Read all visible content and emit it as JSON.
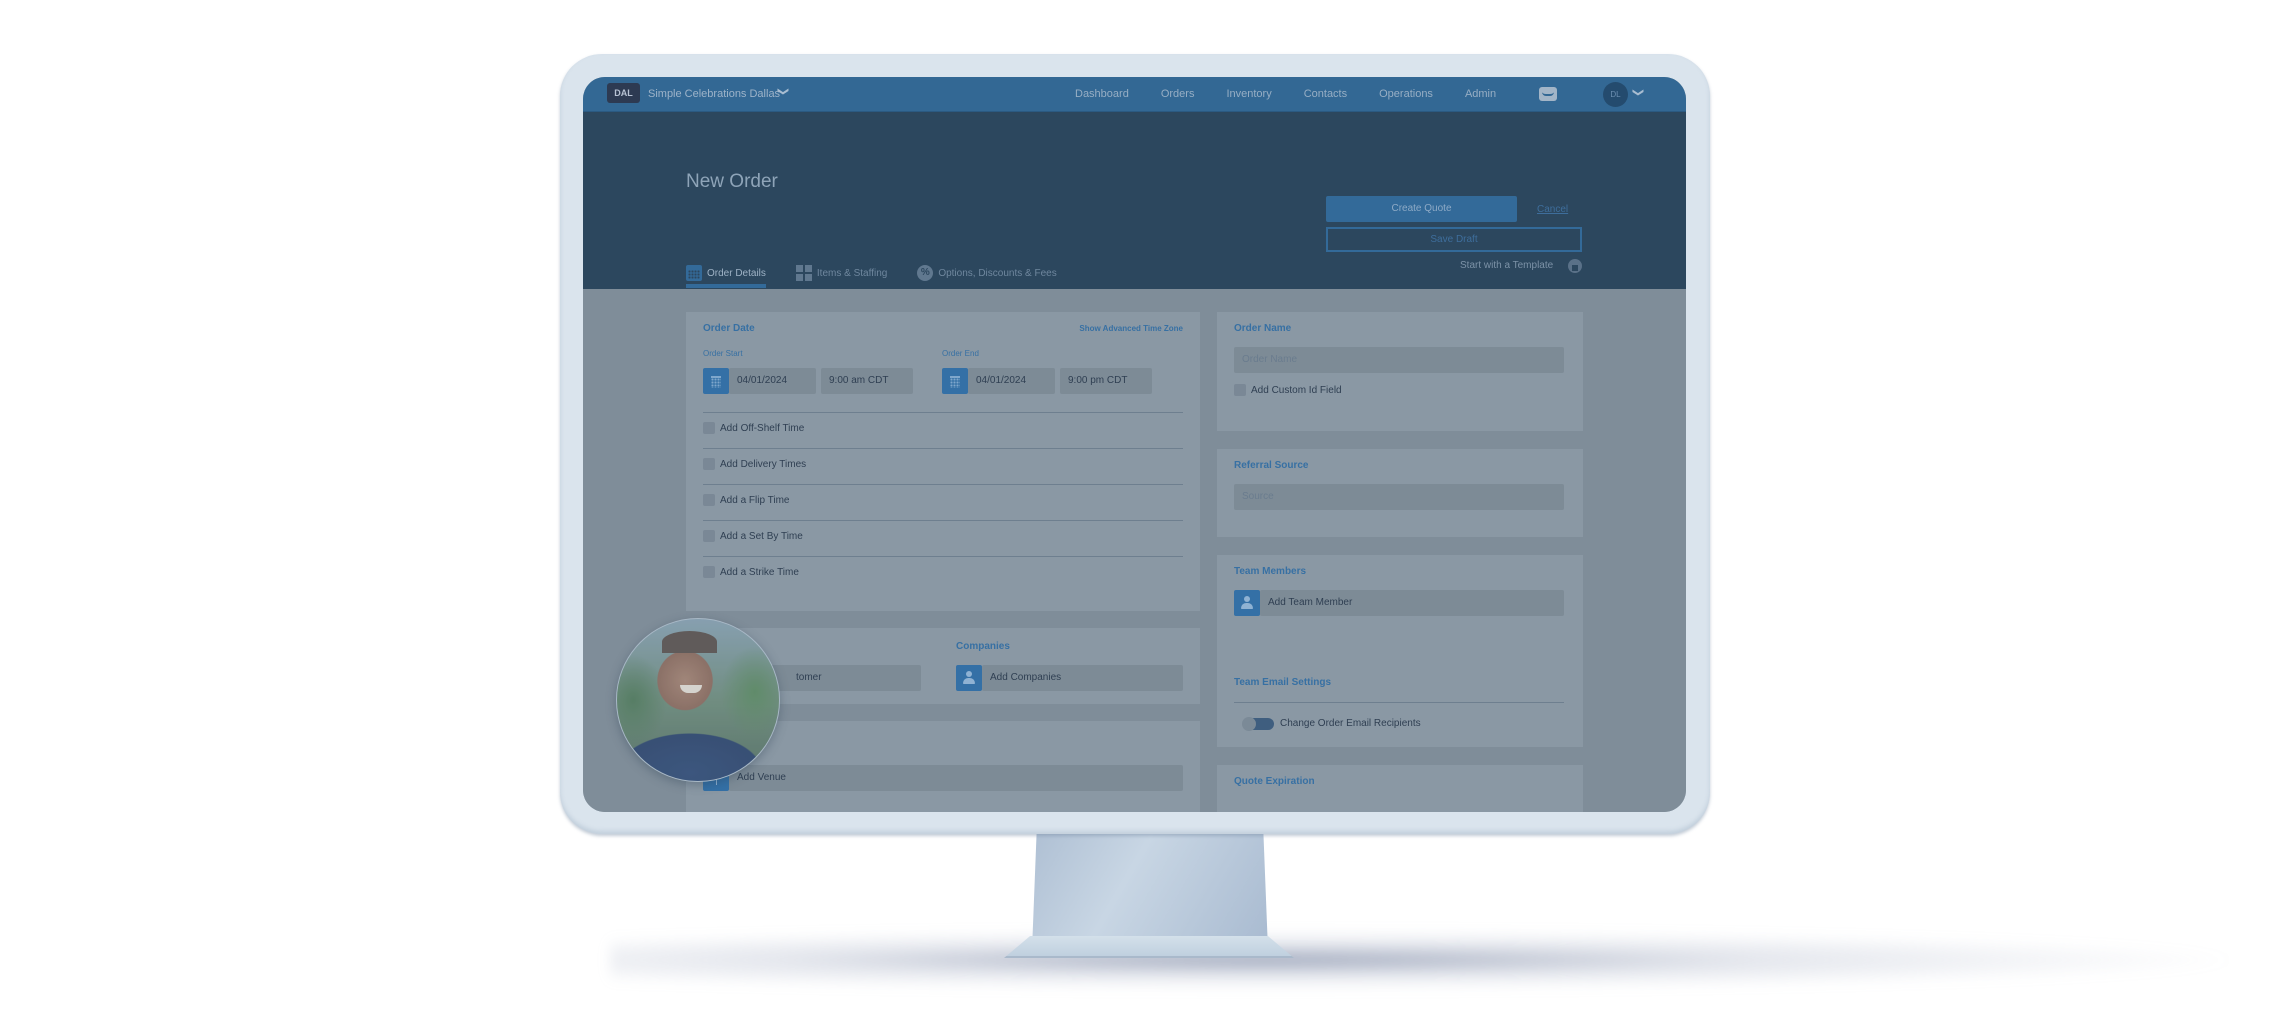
{
  "topnav": {
    "location_badge": "DAL",
    "location_name": "Simple Celebrations Dallas",
    "links": [
      "Dashboard",
      "Orders",
      "Inventory",
      "Contacts",
      "Operations",
      "Admin"
    ],
    "user_initials": "DL"
  },
  "header": {
    "title": "New Order",
    "create_quote": "Create Quote",
    "cancel": "Cancel",
    "save_draft": "Save Draft",
    "template_link": "Start with a Template",
    "tabs": [
      {
        "label": "Order Details",
        "icon": "calendar-icon",
        "active": true
      },
      {
        "label": "Items & Staffing",
        "icon": "grid-icon",
        "active": false
      },
      {
        "label": "Options, Discounts & Fees",
        "icon": "discount-icon",
        "active": false
      }
    ]
  },
  "order_date": {
    "title": "Order Date",
    "advanced_tz": "Show Advanced Time Zone",
    "start_label": "Order Start",
    "start_date": "04/01/2024",
    "start_time": "9:00 am CDT",
    "end_label": "Order End",
    "end_date": "04/01/2024",
    "end_time": "9:00 pm CDT",
    "options": [
      "Add Off-Shelf Time",
      "Add Delivery Times",
      "Add a Flip Time",
      "Add a Set By Time",
      "Add a Strike Time"
    ]
  },
  "customer": {
    "field_text": "tomer"
  },
  "companies": {
    "title": "Companies",
    "field_text": "Add Companies"
  },
  "venue": {
    "field_text": "Add Venue"
  },
  "order_name": {
    "title": "Order Name",
    "placeholder": "Order Name",
    "custom_id": "Add Custom Id Field"
  },
  "referral": {
    "title": "Referral Source",
    "placeholder": "Source"
  },
  "team": {
    "title": "Team Members",
    "field_text": "Add Team Member",
    "email_title": "Team Email Settings",
    "toggle_label": "Change Order Email Recipients",
    "toggle_on": false
  },
  "quote_expiration": {
    "title": "Quote Expiration"
  },
  "colors": {
    "nav": "#336894",
    "header": "#2c475e",
    "accent": "#3470a6",
    "content": "#7f8d99"
  }
}
